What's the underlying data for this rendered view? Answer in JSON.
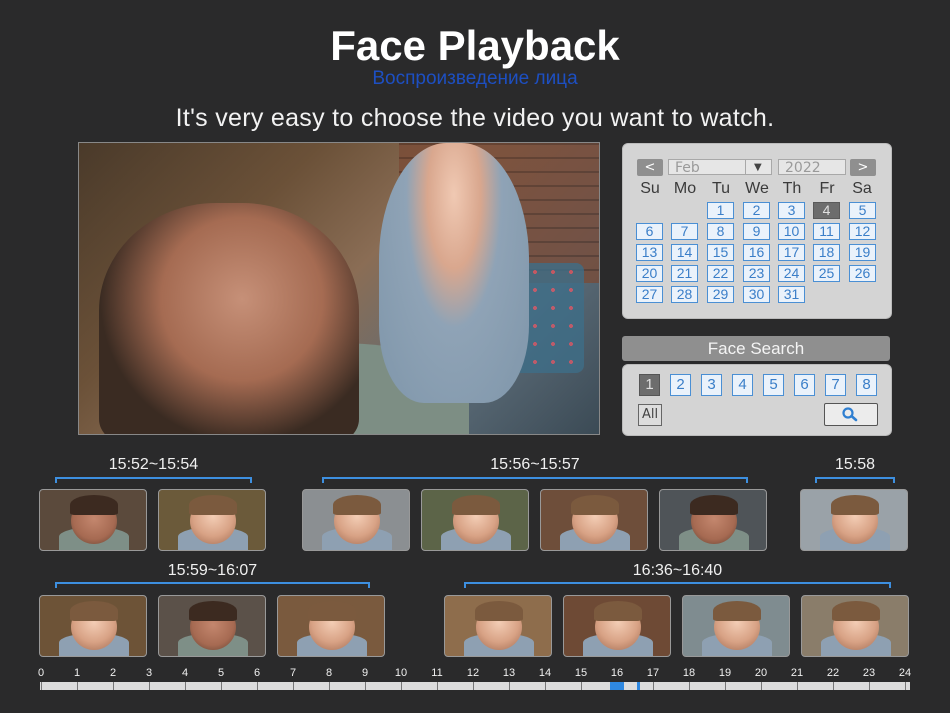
{
  "header": {
    "title": "Face Playback",
    "subtitle_ru": "Воспроизведение лица",
    "tagline": "It's very easy to choose the video you want to watch."
  },
  "calendar": {
    "prev_label": "<",
    "next_label": ">",
    "month": "Feb",
    "dropdown_icon": "▼",
    "year": "2022",
    "weekdays": [
      "Su",
      "Mo",
      "Tu",
      "We",
      "Th",
      "Fr",
      "Sa"
    ],
    "days": [
      "1",
      "2",
      "3",
      "4",
      "5",
      "6",
      "7",
      "8",
      "9",
      "10",
      "11",
      "12",
      "13",
      "14",
      "15",
      "16",
      "17",
      "18",
      "19",
      "20",
      "21",
      "22",
      "23",
      "24",
      "25",
      "26",
      "27",
      "28",
      "29",
      "30",
      "31"
    ],
    "first_weekday_index": 2,
    "selected_day": "4"
  },
  "face_search": {
    "title": "Face Search",
    "channels": [
      "1",
      "2",
      "3",
      "4",
      "5",
      "6",
      "7",
      "8"
    ],
    "selected_channel": "1",
    "all_label": "All",
    "search_icon": "magnifier-icon"
  },
  "groups": [
    {
      "label": "15:52~15:54"
    },
    {
      "label": "15:56~15:57"
    },
    {
      "label": "15:58"
    },
    {
      "label": "15:59~16:07"
    },
    {
      "label": "16:36~16:40"
    }
  ],
  "timeline": {
    "hours": [
      "0",
      "1",
      "2",
      "3",
      "4",
      "5",
      "6",
      "7",
      "8",
      "9",
      "10",
      "11",
      "12",
      "13",
      "14",
      "15",
      "16",
      "17",
      "18",
      "19",
      "20",
      "21",
      "22",
      "23",
      "24"
    ],
    "highlights": [
      [
        15.8,
        16.2
      ],
      [
        16.55,
        16.65
      ]
    ]
  },
  "colors": {
    "accent": "#3d8fe0",
    "background": "#2a2a2b"
  }
}
